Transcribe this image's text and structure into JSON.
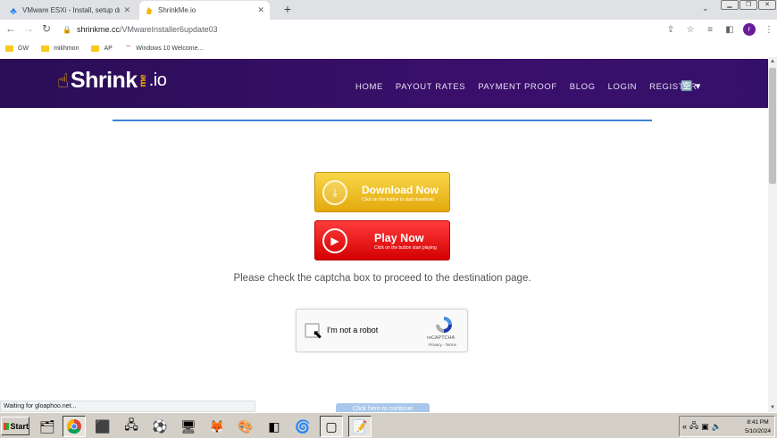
{
  "browser": {
    "tabs": [
      {
        "title": "VMware ESXi - Install, setup driver R",
        "active": false
      },
      {
        "title": "ShrinkMe.io",
        "active": true
      }
    ],
    "new_tab": "+",
    "url_host": "shrinkme.cc",
    "url_path": "/VMwareInstaller6update03",
    "profile_initial": "r"
  },
  "bookmarks": [
    {
      "label": "GW"
    },
    {
      "label": "mikhmon"
    },
    {
      "label": "AP"
    },
    {
      "label": "Windows 10 Welcome..."
    }
  ],
  "site": {
    "logo": {
      "part1": "Shrink",
      "me": "me",
      "io": ".io"
    },
    "menu": [
      "HOME",
      "PAYOUT RATES",
      "PAYMENT PROOF",
      "BLOG",
      "LOGIN",
      "REGISTER"
    ],
    "download_button": {
      "title": "Download Now",
      "subtitle": "Click on the button to start download"
    },
    "play_button": {
      "title": "Play Now",
      "subtitle": "Click on the button start playing"
    },
    "captcha_message": "Please check the captcha box to proceed to the destination page.",
    "recaptcha": {
      "label": "I'm not a robot",
      "brand": "reCAPTCHA",
      "terms": "Privacy - Terms"
    },
    "hidden_button": "Click here to continue"
  },
  "status_bar": "Waiting for gloaphoo.net...",
  "taskbar": {
    "start": "Start",
    "time": "8:41 PM",
    "date": "5/10/2024"
  },
  "colors": {
    "nav_bg": "#2a0e56",
    "accent_blue": "#3b82d6",
    "download_yellow": "#f4c430",
    "play_red": "#e60000"
  }
}
